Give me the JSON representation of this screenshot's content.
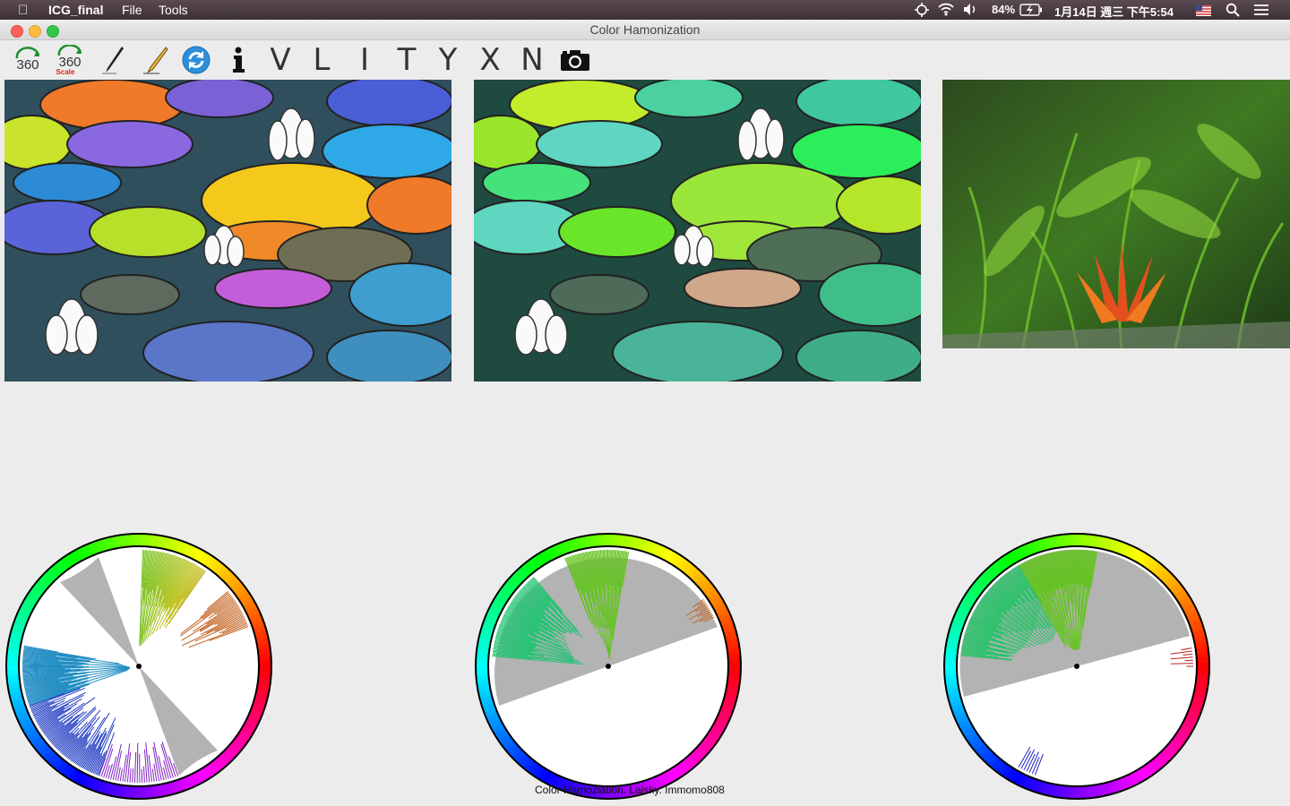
{
  "menubar": {
    "app_name": "ICG_final",
    "menus": [
      "File",
      "Tools"
    ],
    "battery": "84%",
    "datetime": "1月14日 週三 下午5:54"
  },
  "window": {
    "title": "Color Hamonization"
  },
  "toolbar": {
    "rotate_label": "360",
    "scale_label": "360",
    "scale_sub": "Scale",
    "templates": [
      "V",
      "L",
      "I",
      "T",
      "Y",
      "X",
      "N"
    ]
  },
  "footer": {
    "credit": "Color Hamoziation. Laisky. Immomo808"
  },
  "colors": {
    "gray_sector": "#b3b3b3",
    "window_bg": "#ececec",
    "menubar_bg": "#3d3036"
  },
  "icons": [
    "apple-icon",
    "rotate-360-icon",
    "scale-360-icon",
    "pen-icon",
    "pencil-icon",
    "refresh-icon",
    "info-icon",
    "camera-icon",
    "wifi-icon",
    "volume-icon",
    "battery-icon",
    "search-icon",
    "list-icon"
  ]
}
